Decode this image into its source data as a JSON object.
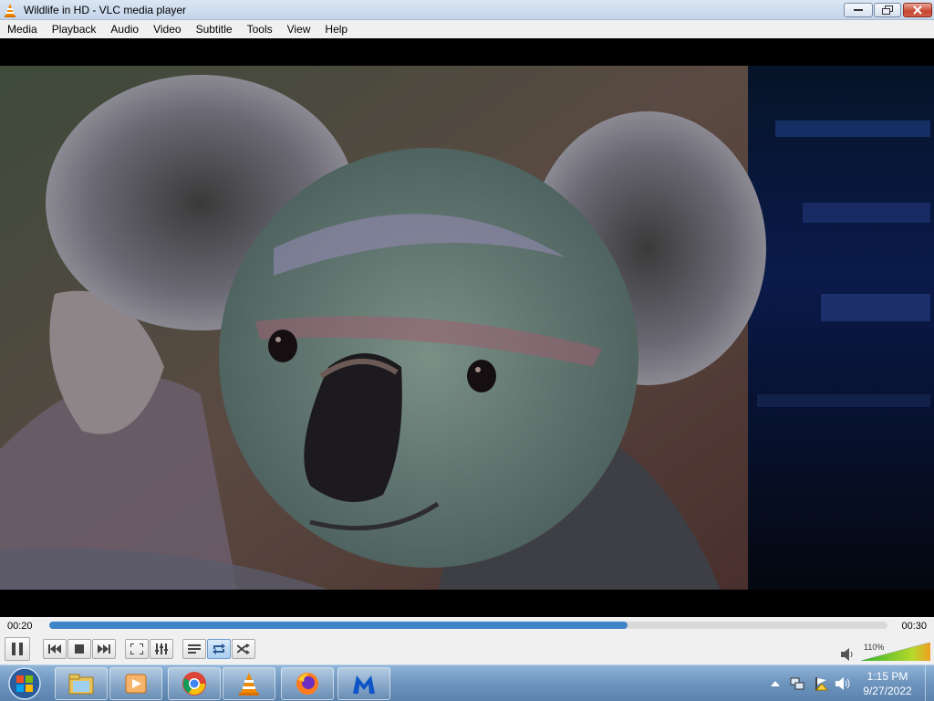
{
  "window": {
    "title": "Wildlife in HD - VLC media player"
  },
  "menu": {
    "items": [
      "Media",
      "Playback",
      "Audio",
      "Video",
      "Subtitle",
      "Tools",
      "View",
      "Help"
    ]
  },
  "player": {
    "elapsed": "00:20",
    "duration": "00:30",
    "progress_fraction": 0.69,
    "volume_label": "110%",
    "volume_fraction": 1.0,
    "loop_active": true
  },
  "taskbar": {
    "apps": [
      "windows-explorer-icon",
      "media-player-icon",
      "chrome-icon",
      "vlc-icon",
      "firefox-icon",
      "malwarebytes-icon"
    ],
    "clock_time": "1:15 PM",
    "clock_date": "9/27/2022"
  },
  "colors": {
    "accent": "#3f83c8",
    "taskbar": "#6d94bd"
  }
}
